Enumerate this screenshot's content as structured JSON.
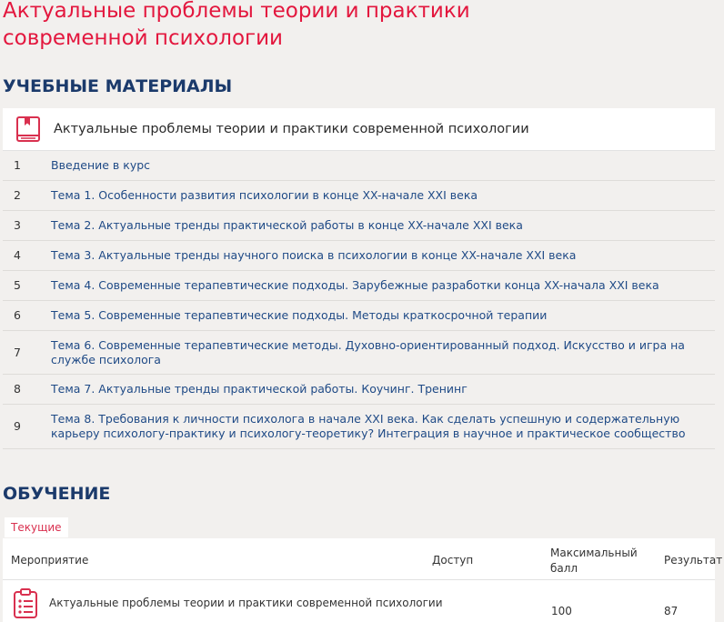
{
  "page": {
    "title": "Актуальные проблемы теории и практики современной психологии"
  },
  "materials": {
    "heading": "УЧЕБНЫЕ МАТЕРИАЛЫ",
    "card_title": "Актуальные проблемы теории и практики современной психологии",
    "card_icon": "book-icon",
    "items": [
      {
        "num": "1",
        "label": "Введение в курс"
      },
      {
        "num": "2",
        "label": "Тема 1. Особенности развития психологии в конце XX-начале XXI века"
      },
      {
        "num": "3",
        "label": "Тема 2. Актуальные тренды практической работы в конце XX-начале XXI века"
      },
      {
        "num": "4",
        "label": "Тема 3. Актуальные тренды научного поиска в психологии в конце XX-начале XXI века"
      },
      {
        "num": "5",
        "label": "Тема 4. Современные терапевтические подходы. Зарубежные разработки конца XX-начала XXI века"
      },
      {
        "num": "6",
        "label": "Тема 5. Современные терапевтические подходы. Методы краткосрочной терапии"
      },
      {
        "num": "7",
        "label": "Тема 6. Современные терапевтические методы. Духовно-ориентированный подход. Искусство и игра на службе психолога"
      },
      {
        "num": "8",
        "label": "Тема 7. Актуальные тренды практической работы. Коучинг. Тренинг"
      },
      {
        "num": "9",
        "label": "Тема 8. Требования к личности психолога в начале XXI века. Как сделать успешную и содержательную карьеру психологу-практику и психологу-теоретику? Интеграция в научное и практическое сообщество"
      }
    ]
  },
  "study": {
    "heading": "ОБУЧЕНИЕ",
    "tab_current": "Текущие",
    "columns": {
      "event": "Мероприятие",
      "access": "Доступ",
      "max_score": "Максимальный балл",
      "result": "Результат"
    },
    "rows": [
      {
        "name": "Актуальные проблемы теории и практики современной психологии",
        "access": "",
        "max_score": "100",
        "result": "87",
        "icon": "clipboard-icon"
      }
    ]
  },
  "colors": {
    "accent_red": "#e3173e",
    "heading_navy": "#1b3a6b",
    "link_blue": "#1f4a86",
    "background": "#f2f0ee"
  }
}
